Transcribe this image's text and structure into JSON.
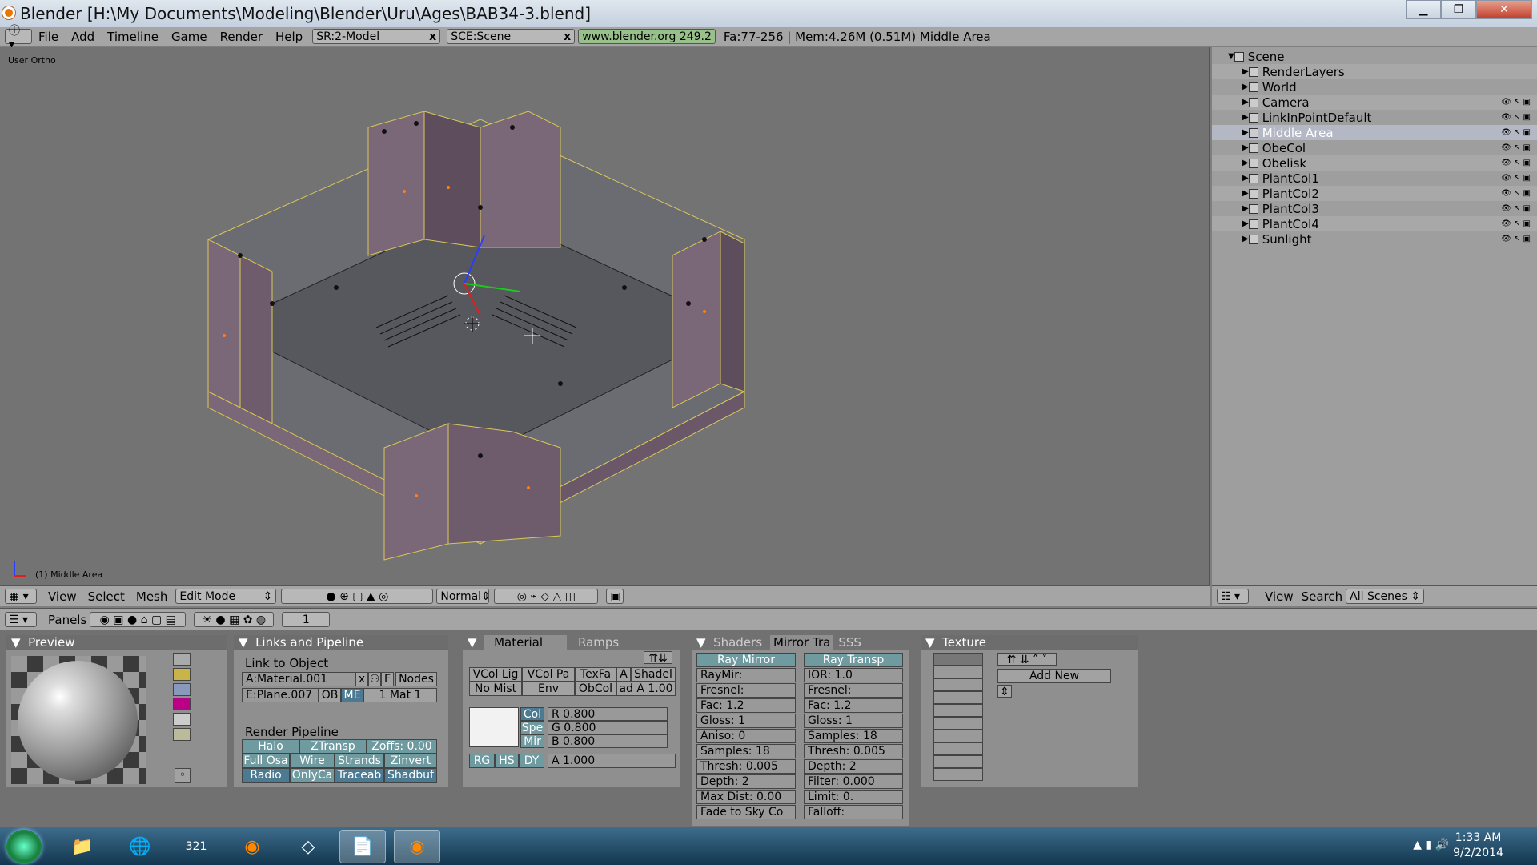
{
  "window": {
    "title": "Blender [H:\\My Documents\\Modeling\\Blender\\Uru\\Ages\\BAB34-3.blend]"
  },
  "menubar": {
    "items": [
      "File",
      "Add",
      "Timeline",
      "Game",
      "Render",
      "Help"
    ],
    "screen": "SR:2-Model",
    "scene": "SCE:Scene",
    "info": "www.blender.org 249.2",
    "stats": "Fa:77-256 | Mem:4.26M (0.51M) Middle Area"
  },
  "viewport": {
    "label": "User Ortho",
    "status": "(1) Middle Area",
    "colors": {
      "wall": "#7a6777",
      "floor": "#5c5c64",
      "edge": "#d9c85a",
      "dot": "#111111",
      "orange": "#ff7f1a"
    }
  },
  "viewport_header": {
    "menus": [
      "View",
      "Select",
      "Mesh"
    ],
    "mode": "Edit Mode",
    "orientation": "Normal"
  },
  "outliner": {
    "items": [
      {
        "name": "Scene",
        "level": 0
      },
      {
        "name": "RenderLayers",
        "level": 1
      },
      {
        "name": "World",
        "level": 1
      },
      {
        "name": "Camera",
        "level": 1
      },
      {
        "name": "LinkInPointDefault",
        "level": 1
      },
      {
        "name": "Middle Area",
        "level": 1,
        "selected": true
      },
      {
        "name": "ObeCol",
        "level": 1
      },
      {
        "name": "Obelisk",
        "level": 1
      },
      {
        "name": "PlantCol1",
        "level": 1
      },
      {
        "name": "PlantCol2",
        "level": 1
      },
      {
        "name": "PlantCol3",
        "level": 1
      },
      {
        "name": "PlantCol4",
        "level": 1
      },
      {
        "name": "Sunlight",
        "level": 1
      }
    ],
    "header": {
      "view": "View",
      "search": "Search",
      "scenes": "All Scenes"
    }
  },
  "buttons_header": {
    "panels": "Panels",
    "frame": "1"
  },
  "preview": {
    "title": "Preview"
  },
  "links": {
    "title": "Links and Pipeline",
    "link_to_object": "Link to Object",
    "material": "A:Material.001",
    "f": "F",
    "nodes": "Nodes",
    "mesh": "E:Plane.007",
    "ob": "OB",
    "me": "ME",
    "mat": "1 Mat 1",
    "render_pipeline": "Render Pipeline",
    "pipe": [
      "Halo",
      "ZTransp",
      "Zoffs: 0.00",
      "Full Osa",
      "Wire",
      "Strands",
      "Zinvert",
      "Radio",
      "OnlyCa",
      "Traceab",
      "Shadbuf"
    ]
  },
  "material": {
    "tabs": [
      "Material",
      "Ramps"
    ],
    "row1": [
      "VCol Lig",
      "VCol Pa",
      "TexFa",
      "A",
      "Shadel"
    ],
    "row2": [
      "No Mist",
      "Env",
      "ObCol",
      "ad A 1.00"
    ],
    "col": "Col",
    "spe": "Spe",
    "mir": "Mir",
    "r": "R 0.800",
    "g": "G 0.800",
    "b": "B 0.800",
    "rg": "RG",
    "hs": "HS",
    "dy": "DY",
    "a": "A 1.000"
  },
  "mirror": {
    "tabs": [
      "Shaders",
      "Mirror Tra",
      "SSS"
    ],
    "left": [
      "Ray Mirror",
      "RayMir:",
      "Fresnel:",
      "Fac: 1.2",
      "Gloss: 1",
      "Aniso: 0",
      "Samples: 18",
      "Thresh: 0.005",
      "Depth: 2",
      "Max Dist: 0.00",
      "Fade to Sky Co"
    ],
    "right": [
      "Ray Transp",
      "IOR: 1.0",
      "Fresnel:",
      "Fac: 1.2",
      "Gloss: 1",
      "Samples: 18",
      "Thresh: 0.005",
      "Depth: 2",
      "Filter: 0.000",
      "Limit: 0.",
      "Falloff:"
    ]
  },
  "texture": {
    "title": "Texture",
    "add_new": "Add New"
  },
  "taskbar": {
    "time": "1:33 AM",
    "date": "9/2/2014",
    "cal": "321"
  }
}
